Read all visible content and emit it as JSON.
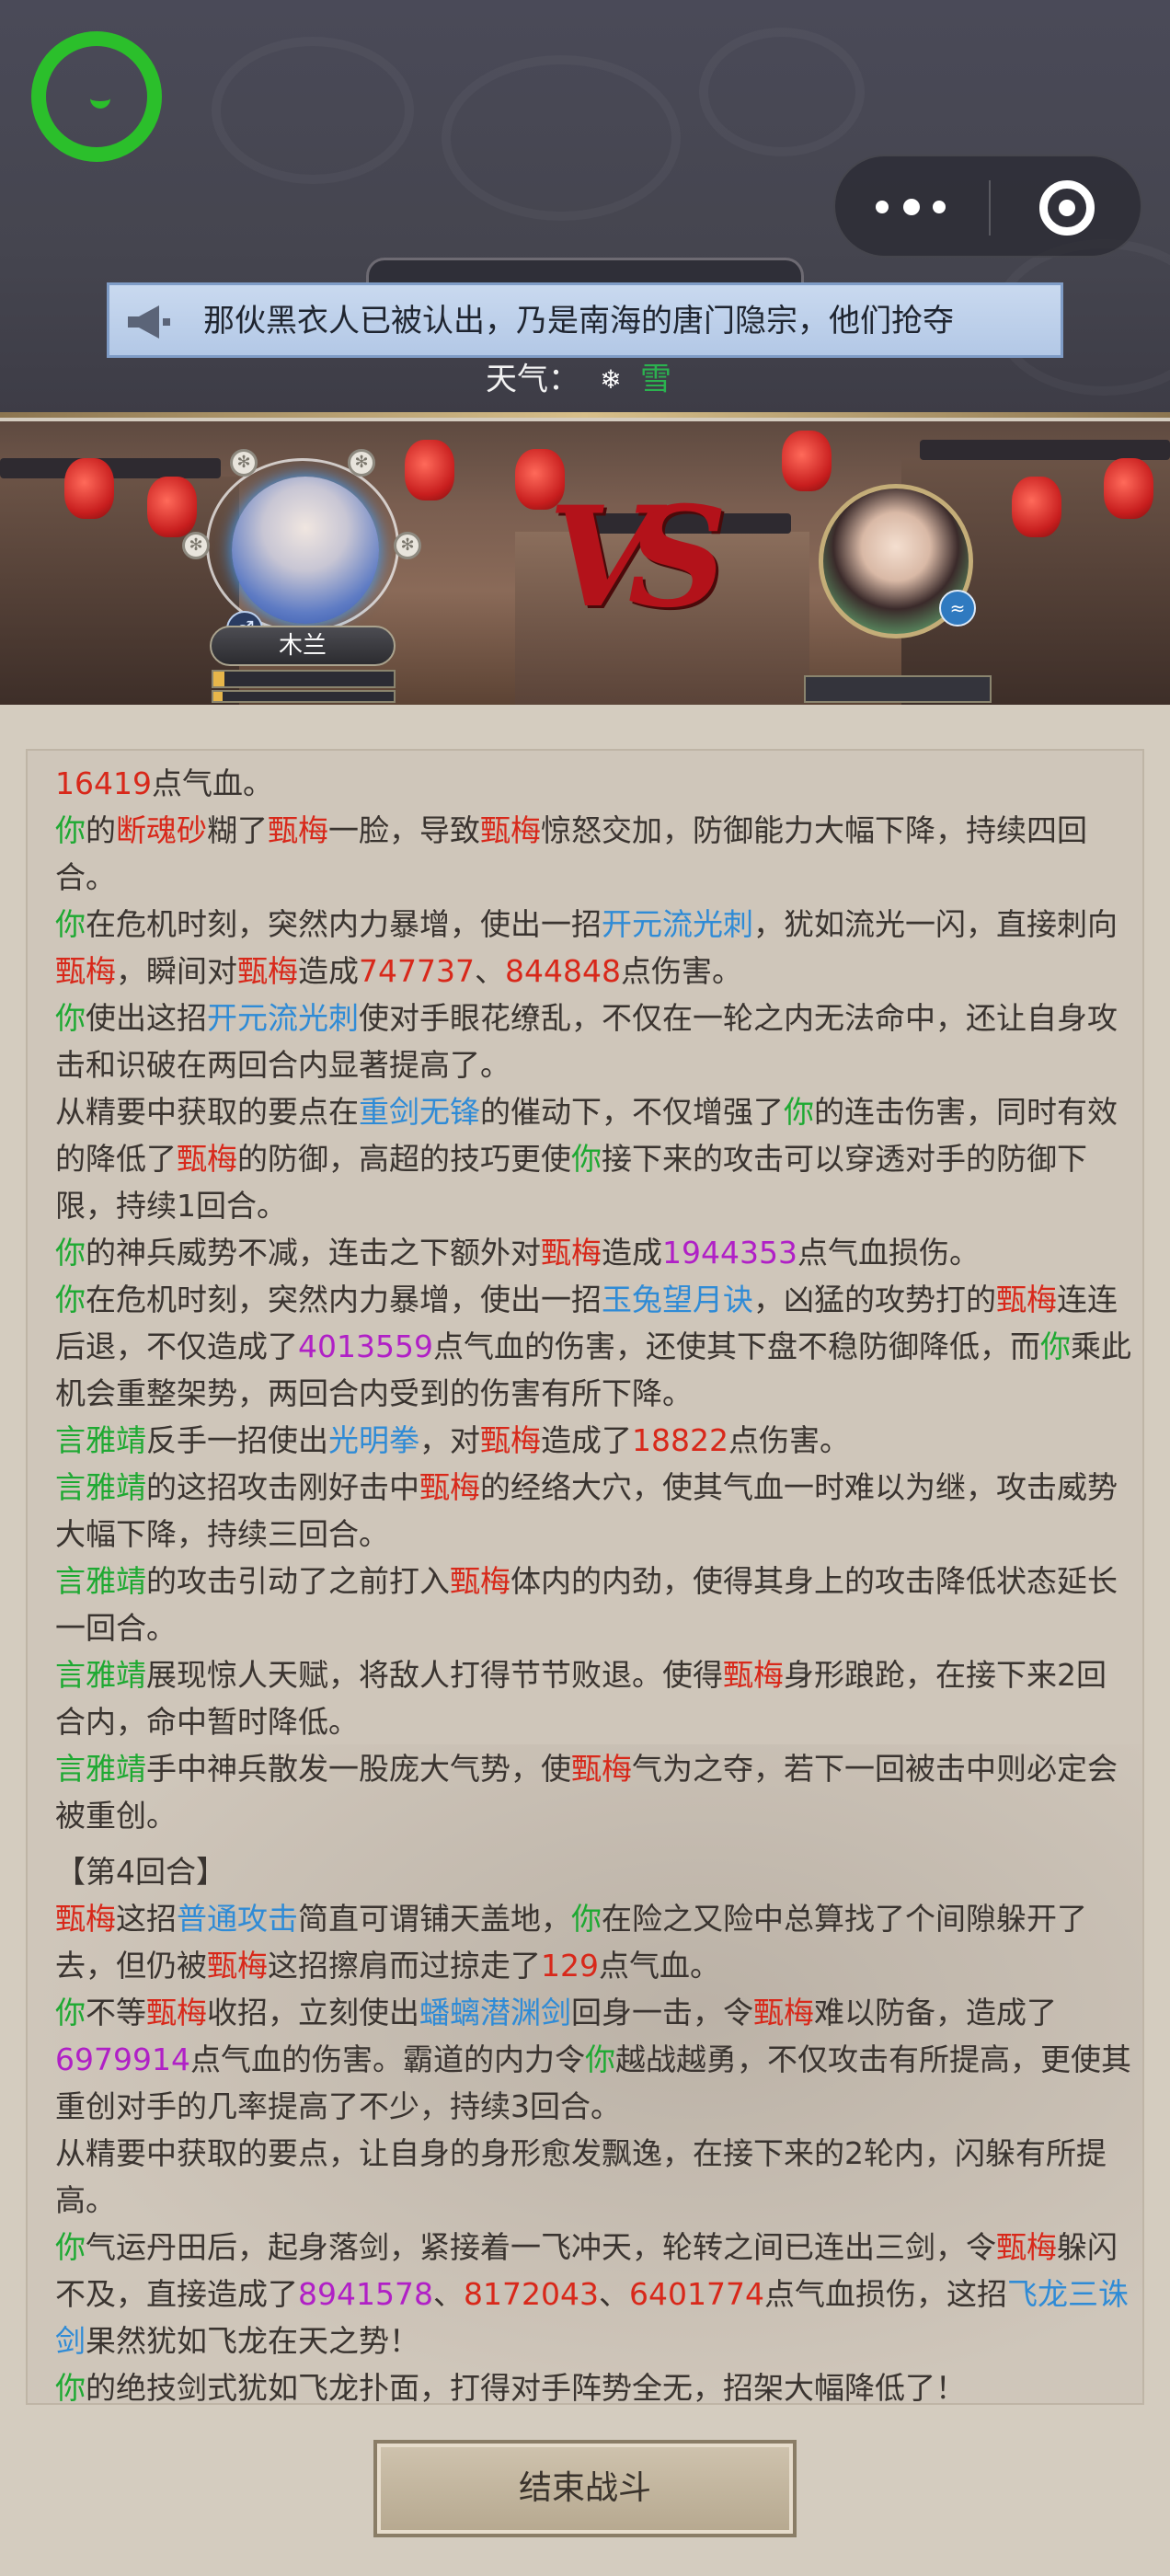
{
  "header": {
    "notice_text": "那伙黑衣人已被认出，乃是南海的唐门隐宗，他们抢夺",
    "weather_label": "天气：",
    "weather_value": "雪",
    "weather_icon": "snowflake-icon"
  },
  "battle": {
    "left_name": "木兰",
    "left_gender_icon": "male-icon",
    "left_hp_fill": 0.06,
    "left_mp_fill": 0.05,
    "vs_text": "VS",
    "right_hp_fill": 0
  },
  "log": {
    "l1": {
      "a": "16419",
      "b": "点气血。"
    },
    "l2": {
      "a": "你",
      "b": "的",
      "c": "断魂砂",
      "d": "糊了",
      "e": "甄梅",
      "f": "一脸，导致",
      "g": "甄梅",
      "h": "惊怒交加，防御能力大幅下降，持续四回合。"
    },
    "l3": {
      "a": "你",
      "b": "在危机时刻，突然内力暴增，使出一招",
      "c": "开元流光刺",
      "d": "，犹如流光一闪，直接刺向",
      "e": "甄梅",
      "f": "，瞬间对",
      "g": "甄梅",
      "h": "造成",
      "i": "747737",
      "j": "、",
      "k": "844848",
      "l": "点伤害。"
    },
    "l4": {
      "a": "你",
      "b": "使出这招",
      "c": "开元流光刺",
      "d": "使对手眼花缭乱，不仅在一轮之内无法命中，还让自身攻击和识破在两回合内显著提高了。"
    },
    "l5": {
      "a": "从精要中获取的要点在",
      "b": "重剑无锋",
      "c": "的催动下，不仅增强了",
      "d": "你",
      "e": "的连击伤害，同时有效的降低了",
      "f": "甄梅",
      "g": "的防御，高超的技巧更使",
      "h": "你",
      "i": "接下来的攻击可以穿透对手的防御下限，持续1回合。"
    },
    "l6": {
      "a": "你",
      "b": "的神兵威势不减，连击之下额外对",
      "c": "甄梅",
      "d": "造成",
      "e": "1944353",
      "f": "点气血损伤。"
    },
    "l7": {
      "a": "你",
      "b": "在危机时刻，突然内力暴增，使出一招",
      "c": "玉兔望月诀",
      "d": "，凶猛的攻势打的",
      "e": "甄梅",
      "f": "连连后退，不仅造成了",
      "g": "4013559",
      "h": "点气血的伤害，还使其下盘不稳防御降低，而",
      "i": "你",
      "j": "乘此机会重整架势，两回合内受到的伤害有所下降。"
    },
    "l8": {
      "a": "言雅靖",
      "b": "反手一招使出",
      "c": "光明拳",
      "d": "，对",
      "e": "甄梅",
      "f": "造成了",
      "g": "18822",
      "h": "点伤害。"
    },
    "l9": {
      "a": "言雅靖",
      "b": "的这招攻击刚好击中",
      "c": "甄梅",
      "d": "的经络大穴，使其气血一时难以为继，攻击威势大幅下降，持续三回合。"
    },
    "l10": {
      "a": "言雅靖",
      "b": "的攻击引动了之前打入",
      "c": "甄梅",
      "d": "体内的内劲，使得其身上的攻击降低状态延长一回合。"
    },
    "l11": {
      "a": "言雅靖",
      "b": "展现惊人天赋，将敌人打得节节败退。使得",
      "c": "甄梅",
      "d": "身形踉跄，在接下来2回合内，命中暂时降低。"
    },
    "l12": {
      "a": "言雅靖",
      "b": "手中神兵散发一股庞大气势，使",
      "c": "甄梅",
      "d": "气为之夺，若下一回被击中则必定会被重创。"
    },
    "round": "【第4回合】",
    "l13": {
      "a": "甄梅",
      "b": "这招",
      "c": "普通攻击",
      "d": "简直可谓铺天盖地，",
      "e": "你",
      "f": "在险之又险中总算找了个间隙躲开了去，但仍被",
      "g": "甄梅",
      "h": "这招擦肩而过掠走了",
      "i": "129",
      "j": "点气血。"
    },
    "l14": {
      "a": "你",
      "b": "不等",
      "c": "甄梅",
      "d": "收招，立刻使出",
      "e": "蟠螭潜渊剑",
      "f": "回身一击，令",
      "g": "甄梅",
      "h": "难以防备，造成了",
      "i": "6979914",
      "j": "点气血的伤害。霸道的内力令",
      "k": "你",
      "l": "越战越勇，不仅攻击有所提高，更使其重创对手的几率提高了不少，持续3回合。"
    },
    "l15": {
      "a": "从精要中获取的要点，让自身的身形愈发飘逸，在接下来的2轮内，闪躲有所提高。"
    },
    "l16": {
      "a": "你",
      "b": "气运丹田后，起身落剑，紧接着一飞冲天，轮转之间已连出三剑，令",
      "c": "甄梅",
      "d": "躲闪不及，直接造成了",
      "e": "8941578",
      "f": "、",
      "g": "8172043",
      "h": "、",
      "i": "6401774",
      "j": "点气血损伤，这招",
      "k": "飞龙三诛剑",
      "l": "果然犹如飞龙在天之势！"
    },
    "l17": {
      "a": "你",
      "b": "的绝技剑式犹如飞龙扑面，打得对手阵势全无，招架大幅降低了！"
    }
  },
  "footer": {
    "end_button": "结束战斗"
  }
}
